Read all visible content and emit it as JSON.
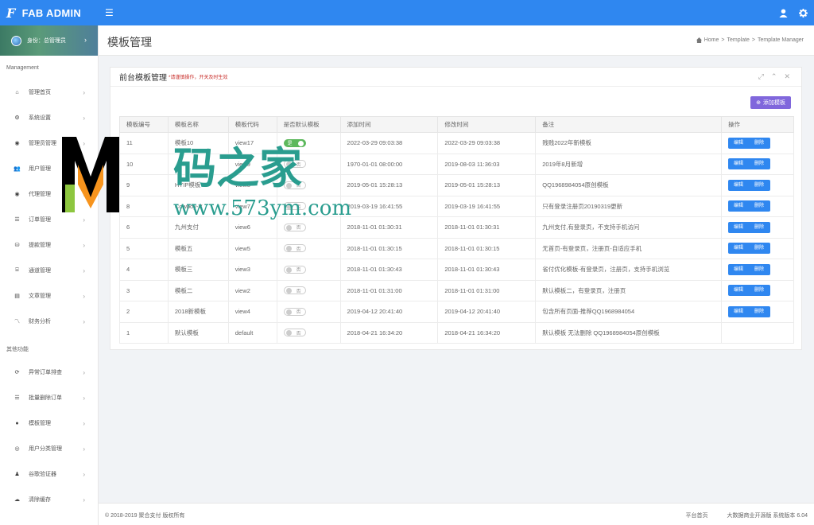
{
  "app": {
    "logo_letter": "F",
    "title": "FAB ADMIN",
    "menu_icon": "☰"
  },
  "sidebar": {
    "profile": "身份：总管理员",
    "sections": [
      {
        "title": "Management",
        "items": [
          {
            "label": "管理首页",
            "icon": "home-icon"
          },
          {
            "label": "系统设置",
            "icon": "cogs-icon"
          },
          {
            "label": "管理员管理",
            "icon": "user-circle-icon"
          },
          {
            "label": "用户管理",
            "icon": "users-icon"
          },
          {
            "label": "代理管理",
            "icon": "user-circle-icon"
          },
          {
            "label": "订单管理",
            "icon": "list-icon"
          },
          {
            "label": "提款管理",
            "icon": "money-bag-icon"
          },
          {
            "label": "通道管理",
            "icon": "bank-icon"
          },
          {
            "label": "文章管理",
            "icon": "book-icon"
          },
          {
            "label": "财务分析",
            "icon": "line-chart-icon"
          }
        ]
      },
      {
        "title": "其他功能",
        "items": [
          {
            "label": "异常订单排查",
            "icon": "refresh-icon"
          },
          {
            "label": "批量删除订单",
            "icon": "list-icon"
          },
          {
            "label": "模板管理",
            "icon": "apple-icon"
          },
          {
            "label": "用户分类管理",
            "icon": "wechat-icon"
          },
          {
            "label": "谷歌验证器",
            "icon": "user-icon"
          },
          {
            "label": "清除缓存",
            "icon": "cloud-icon"
          }
        ]
      }
    ]
  },
  "page": {
    "title": "模板管理",
    "breadcrumb": [
      "Home",
      "Template",
      "Template Manager"
    ]
  },
  "panel": {
    "title": "前台模板管理",
    "warning": "*请谨慎操作，开关及时生效",
    "add_button": "添加模板",
    "columns": [
      "模板编号",
      "模板名称",
      "模板代码",
      "是否默认模板",
      "添加时间",
      "修改时间",
      "备注",
      "操作"
    ],
    "rows": [
      {
        "id": "11",
        "name": "模板10",
        "code": "view17",
        "default": true,
        "default_label": "是",
        "added": "2022-03-29 09:03:38",
        "modified": "2022-03-29 09:03:38",
        "note": "贱贱2022年新模板",
        "ops": true
      },
      {
        "id": "10",
        "name": "",
        "code": "view9",
        "default": false,
        "default_label": "否",
        "added": "1970-01-01 08:00:00",
        "modified": "2019-08-03 11:36:03",
        "note": "2019年8月新增",
        "ops": true
      },
      {
        "id": "9",
        "name": "HYIP模板",
        "code": "view8",
        "default": false,
        "default_label": "否",
        "added": "2019-05-01 15:28:13",
        "modified": "2019-05-01 15:28:13",
        "note": "QQ1968984054原创模板",
        "ops": true
      },
      {
        "id": "8",
        "name": "Cowboy-V",
        "code": "view7",
        "default": false,
        "default_label": "否",
        "added": "2019-03-19 16:41:55",
        "modified": "2019-03-19 16:41:55",
        "note": "只有登录注册页20190319更新",
        "ops": true
      },
      {
        "id": "6",
        "name": "九州支付",
        "code": "view6",
        "default": false,
        "default_label": "否",
        "added": "2018-11-01 01:30:31",
        "modified": "2018-11-01 01:30:31",
        "note": "九州支付,有登录页，不支持手机访问",
        "ops": true
      },
      {
        "id": "5",
        "name": "模板五",
        "code": "view5",
        "default": false,
        "default_label": "否",
        "added": "2018-11-01 01:30:15",
        "modified": "2018-11-01 01:30:15",
        "note": "无首页-有登录页，注册页-自适应手机",
        "ops": true
      },
      {
        "id": "4",
        "name": "模板三",
        "code": "view3",
        "default": false,
        "default_label": "否",
        "added": "2018-11-01 01:30:43",
        "modified": "2018-11-01 01:30:43",
        "note": "省付优化模板-有登录页，注册页，支持手机浏览",
        "ops": true
      },
      {
        "id": "3",
        "name": "模板二",
        "code": "view2",
        "default": false,
        "default_label": "否",
        "added": "2018-11-01 01:31:00",
        "modified": "2018-11-01 01:31:00",
        "note": "默认模板二，有登录页，注册页",
        "ops": true
      },
      {
        "id": "2",
        "name": "2018新模板",
        "code": "view4",
        "default": false,
        "default_label": "否",
        "added": "2019-04-12 20:41:40",
        "modified": "2019-04-12 20:41:40",
        "note": "包含所有页面-推荐QQ1968984054",
        "ops": true
      },
      {
        "id": "1",
        "name": "默认模板",
        "code": "default",
        "default": false,
        "default_label": "否",
        "added": "2018-04-21 16:34:20",
        "modified": "2018-04-21 16:34:20",
        "note": "默认模板 无法删除 QQ1968984054原创模板",
        "ops": false
      }
    ],
    "edit_label": "编辑",
    "delete_label": "删除"
  },
  "watermark": {
    "title": "码之家",
    "url": "www.573ym.com"
  },
  "footer": {
    "copyright": "© 2018-2019 聚合支付 版权所有",
    "links": [
      "平台首页",
      "大数据商业开源版 系统版本 6.04"
    ]
  },
  "colors": {
    "primary": "#2f87f0",
    "accent": "#8067dc",
    "success": "#5cb85c",
    "warning": "#c9302c"
  }
}
